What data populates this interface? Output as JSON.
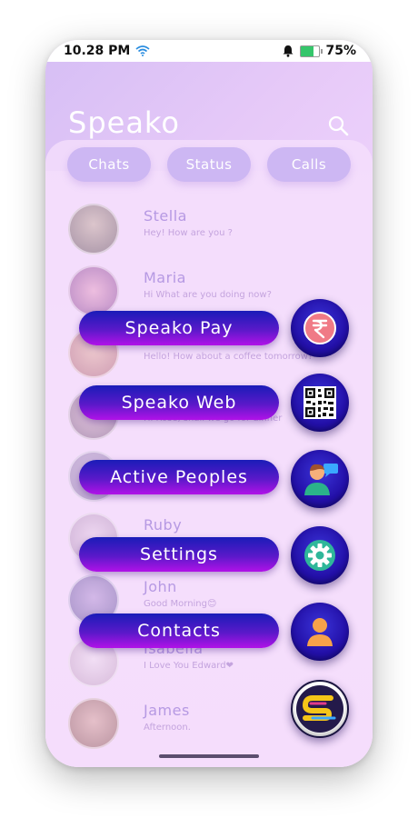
{
  "status_bar": {
    "time": "10.28 PM",
    "battery": "75%"
  },
  "header": {
    "title": "Speako"
  },
  "tabs": [
    {
      "label": "Chats"
    },
    {
      "label": "Status"
    },
    {
      "label": "Calls"
    }
  ],
  "chats": [
    {
      "name": "Stella",
      "message": "Hey! How are you ?"
    },
    {
      "name": "Maria",
      "message": "Hi What are you doing now?"
    },
    {
      "name": "",
      "message": "Hello! How about a coffee tomorrow?"
    },
    {
      "name": "",
      "message": "Hi Rose, shall we go for dinner"
    },
    {
      "name": "",
      "message": ""
    },
    {
      "name": "Ruby",
      "message": ""
    },
    {
      "name": "John",
      "message": "Good Morning😊"
    },
    {
      "name": "Isabella",
      "message": "I Love You Edward❤"
    },
    {
      "name": "James",
      "message": "Afternoon."
    }
  ],
  "fab_menu": {
    "items": [
      {
        "label": "Speako Pay",
        "icon": "rupee-icon"
      },
      {
        "label": "Speako Web",
        "icon": "qr-code-icon"
      },
      {
        "label": "Active Peoples",
        "icon": "active-people-icon"
      },
      {
        "label": "Settings",
        "icon": "gear-icon"
      },
      {
        "label": "Contacts",
        "icon": "contact-icon"
      }
    ],
    "main_icon": "speako-logo-icon"
  },
  "colors": {
    "accent": "#2310a8",
    "pill_end": "#b112e8",
    "background": "#f1d6fb"
  }
}
